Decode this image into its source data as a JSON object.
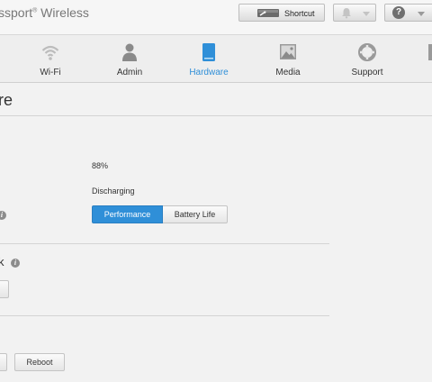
{
  "header": {
    "brand": "ssport",
    "brand_reg": "®",
    "brand_suffix": " Wireless",
    "shortcut_label": "Shortcut"
  },
  "nav": {
    "items": [
      {
        "label": "Wi-Fi",
        "icon": "wifi-icon",
        "active": false
      },
      {
        "label": "Admin",
        "icon": "admin-user-icon",
        "active": false
      },
      {
        "label": "Hardware",
        "icon": "hardware-drive-icon",
        "active": true
      },
      {
        "label": "Media",
        "icon": "media-image-icon",
        "active": false
      },
      {
        "label": "Support",
        "icon": "support-lifebuoy-icon",
        "active": false
      }
    ]
  },
  "page": {
    "title_fragment": "re",
    "battery_level": "88%",
    "battery_status": "Discharging",
    "mode_options": [
      "Performance",
      "Battery Life"
    ],
    "mode_selected": "Performance",
    "section2_fragment": "k",
    "reboot_label": "Reboot"
  },
  "colors": {
    "accent": "#2f8fd8"
  }
}
